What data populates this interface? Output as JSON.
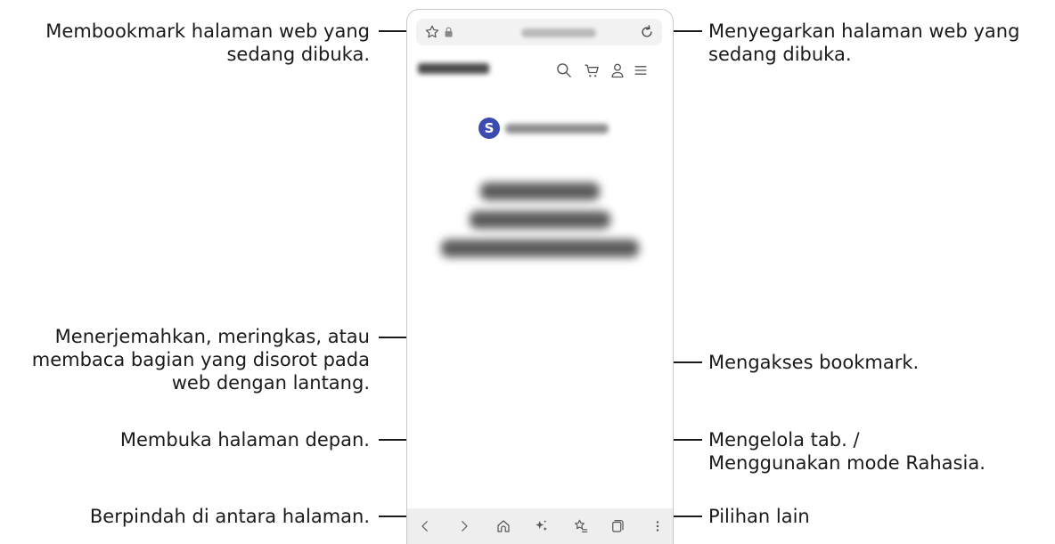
{
  "callouts": {
    "bookmark_page": [
      "Membookmark halaman web yang",
      "sedang dibuka."
    ],
    "refresh": [
      "Menyegarkan halaman web yang",
      "sedang dibuka."
    ],
    "translate": [
      "Menerjemahkan, meringkas, atau",
      "membaca bagian yang disorot pada",
      "web dengan lantang."
    ],
    "home": [
      "Membuka halaman depan."
    ],
    "navigate": [
      "Berpindah di antara halaman."
    ],
    "bookmarks": [
      "Mengakses bookmark."
    ],
    "tabs": [
      "Mengelola tab. /",
      "Menggunakan mode Rahasia."
    ],
    "more": [
      "Pilihan lain"
    ]
  },
  "phone": {
    "app_logo_letter": "S"
  },
  "icons": {
    "star": "star-outline-icon",
    "lock": "lock-icon",
    "refresh": "refresh-icon",
    "search": "search-icon",
    "cart": "cart-icon",
    "account": "user-icon",
    "menu": "hamburger-menu-icon",
    "back": "chevron-left-icon",
    "forward": "chevron-right-icon",
    "home": "home-icon",
    "ai": "sparkle-icon",
    "bookmarks": "bookmark-list-icon",
    "tabs": "tabs-icon",
    "more": "more-vertical-icon"
  },
  "colors": {
    "app_logo": "#3b4bb0",
    "nav_bar": "#eeeeee",
    "leader_line": "#1a1a1a"
  }
}
